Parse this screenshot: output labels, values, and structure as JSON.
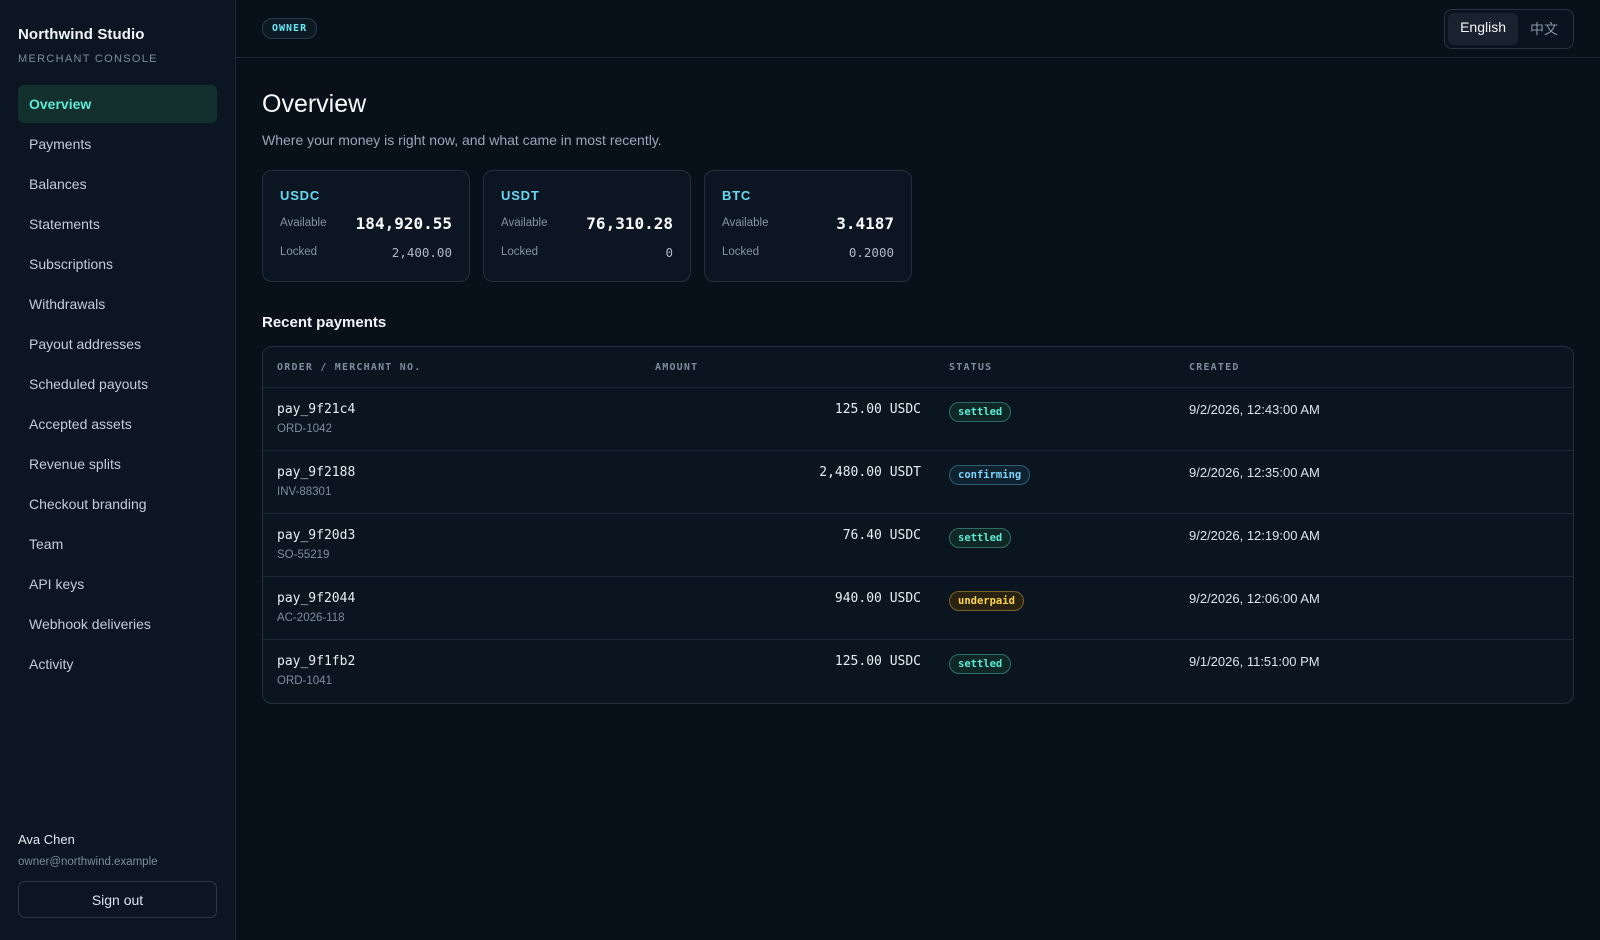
{
  "brand": {
    "name": "Northwind Studio",
    "subtitle": "MERCHANT CONSOLE"
  },
  "nav": [
    {
      "label": "Overview",
      "active": true
    },
    {
      "label": "Payments"
    },
    {
      "label": "Balances"
    },
    {
      "label": "Statements"
    },
    {
      "label": "Subscriptions"
    },
    {
      "label": "Withdrawals"
    },
    {
      "label": "Payout addresses"
    },
    {
      "label": "Scheduled payouts"
    },
    {
      "label": "Accepted assets"
    },
    {
      "label": "Revenue splits"
    },
    {
      "label": "Checkout branding"
    },
    {
      "label": "Team"
    },
    {
      "label": "API keys"
    },
    {
      "label": "Webhook deliveries"
    },
    {
      "label": "Activity"
    }
  ],
  "user": {
    "name": "Ava Chen",
    "email": "owner@northwind.example",
    "signout_label": "Sign out"
  },
  "topbar": {
    "role": "OWNER",
    "languages": [
      {
        "label": "English",
        "active": true
      },
      {
        "label": "中文"
      }
    ]
  },
  "page": {
    "title": "Overview",
    "subtitle": "Where your money is right now, and what came in most recently."
  },
  "balances": [
    {
      "asset": "USDC",
      "available_label": "Available",
      "available": "184,920.55",
      "locked_label": "Locked",
      "locked": "2,400.00"
    },
    {
      "asset": "USDT",
      "available_label": "Available",
      "available": "76,310.28",
      "locked_label": "Locked",
      "locked": "0"
    },
    {
      "asset": "BTC",
      "available_label": "Available",
      "available": "3.4187",
      "locked_label": "Locked",
      "locked": "0.2000"
    }
  ],
  "recent": {
    "title": "Recent payments",
    "columns": {
      "order": "ORDER / MERCHANT NO.",
      "amount": "AMOUNT",
      "status": "STATUS",
      "created": "CREATED"
    },
    "rows": [
      {
        "id": "pay_9f21c4",
        "ref": "ORD-1042",
        "amount": "125.00 USDC",
        "status": "settled",
        "created": "9/2/2026, 12:43:00 AM"
      },
      {
        "id": "pay_9f2188",
        "ref": "INV-88301",
        "amount": "2,480.00 USDT",
        "status": "confirming",
        "created": "9/2/2026, 12:35:00 AM"
      },
      {
        "id": "pay_9f20d3",
        "ref": "SO-55219",
        "amount": "76.40 USDC",
        "status": "settled",
        "created": "9/2/2026, 12:19:00 AM"
      },
      {
        "id": "pay_9f2044",
        "ref": "AC-2026-118",
        "amount": "940.00 USDC",
        "status": "underpaid",
        "created": "9/2/2026, 12:06:00 AM"
      },
      {
        "id": "pay_9f1fb2",
        "ref": "ORD-1041",
        "amount": "125.00 USDC",
        "status": "settled",
        "created": "9/1/2026, 11:51:00 PM"
      }
    ]
  }
}
